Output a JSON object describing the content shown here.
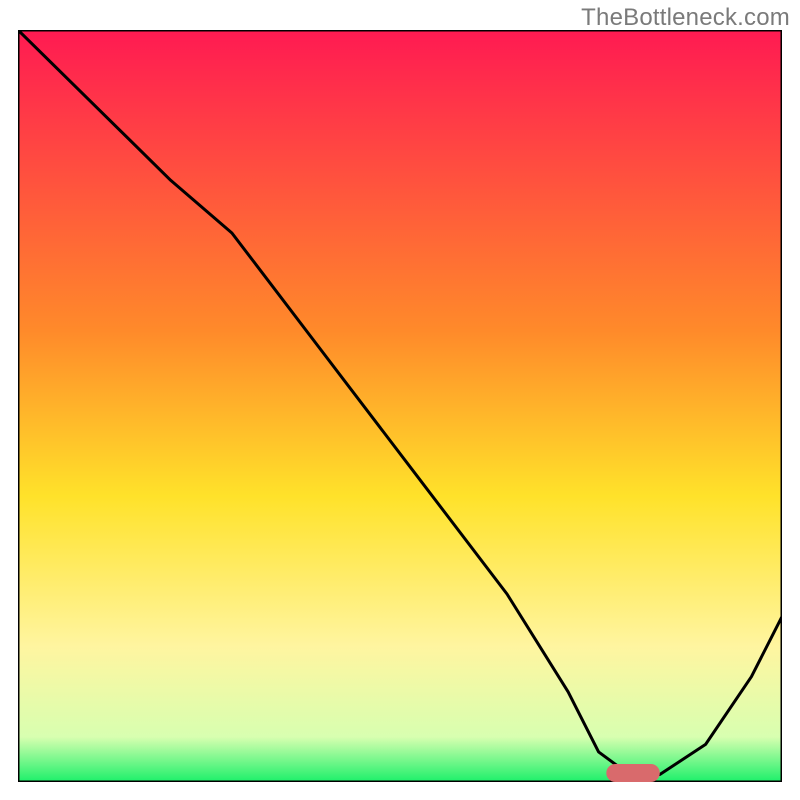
{
  "watermark": "TheBottleneck.com",
  "chart_data": {
    "type": "line",
    "title": "",
    "xlabel": "",
    "ylabel": "",
    "xlim": [
      0,
      100
    ],
    "ylim": [
      0,
      100
    ],
    "grid": false,
    "legend": false,
    "gradient_stops": [
      {
        "offset": 0,
        "color": "#ff1a52"
      },
      {
        "offset": 40,
        "color": "#ff8a2a"
      },
      {
        "offset": 62,
        "color": "#ffe22a"
      },
      {
        "offset": 82,
        "color": "#fff5a0"
      },
      {
        "offset": 94,
        "color": "#d8ffb0"
      },
      {
        "offset": 100,
        "color": "#1cf06a"
      }
    ],
    "series": [
      {
        "name": "bottleneck-curve",
        "color": "#000000",
        "x": [
          0,
          10,
          20,
          28,
          40,
          52,
          64,
          72,
          76,
          80,
          84,
          90,
          96,
          100
        ],
        "y": [
          100,
          90,
          80,
          73,
          57,
          41,
          25,
          12,
          4,
          1,
          1,
          5,
          14,
          22
        ]
      }
    ],
    "marker": {
      "name": "optimal-range",
      "x_start": 77,
      "x_end": 84,
      "y": 1.2,
      "color": "#d96a6c",
      "thickness": 2.4
    }
  }
}
